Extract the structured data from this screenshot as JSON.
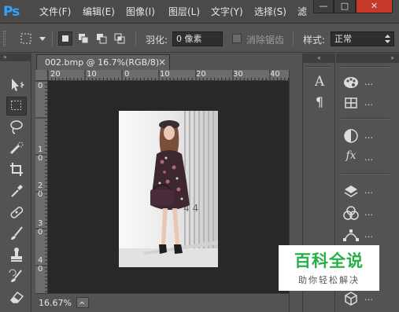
{
  "app": {
    "logo": "Ps"
  },
  "menu": {
    "items": [
      "文件(F)",
      "编辑(E)",
      "图像(I)",
      "图层(L)",
      "文字(Y)",
      "选择(S)",
      "滤"
    ]
  },
  "window_controls": {
    "minimize": "—",
    "maximize": "□",
    "close": "✕"
  },
  "options": {
    "feather_label": "羽化:",
    "feather_value": "0 像素",
    "antialias_label": "消除锯齿",
    "style_label": "样式:",
    "style_value": "正常"
  },
  "document": {
    "tab_title": "002.bmp @ 16.7%(RGB/8)",
    "close_glyph": "×",
    "zoom": "16.67%",
    "ruler_h_labels": [
      "20",
      "10",
      "0",
      "10",
      "20",
      "30",
      "40"
    ],
    "ruler_v_labels": [
      "0",
      "1 0",
      "2 0",
      "3 0",
      "4 0"
    ]
  },
  "panels": {
    "dots": "…",
    "text_panel_glyph": "A",
    "paragraph_glyph": "¶",
    "fx_glyph": "fx"
  },
  "watermark": {
    "title": "百科全说",
    "subtitle": "助你轻松解决"
  },
  "colors": {
    "ps_blue": "#2fa3ff",
    "watermark_green": "#27b04a",
    "ui_bg": "#535353",
    "canvas_bg": "#282828"
  }
}
